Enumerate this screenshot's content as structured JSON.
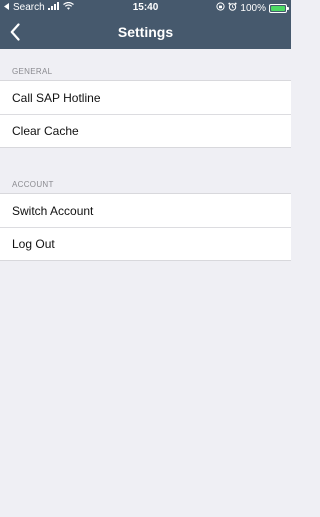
{
  "status_bar": {
    "carrier": "Search",
    "time": "15:40",
    "battery_percent": "100%",
    "battery_level": 1.0,
    "icons": [
      "back-arrow-small-icon",
      "signal-bars-icon",
      "wifi-icon",
      "orientation-lock-icon",
      "alarm-icon",
      "battery-charging-icon"
    ]
  },
  "nav": {
    "title": "Settings",
    "back_icon": "chevron-left-icon"
  },
  "sections": {
    "general": {
      "header": "GENERAL",
      "items": [
        "Call SAP Hotline",
        "Clear Cache"
      ]
    },
    "account": {
      "header": "ACCOUNT",
      "items": [
        "Switch Account",
        "Log Out"
      ]
    }
  },
  "colors": {
    "header_bg": "#46596d",
    "page_bg": "#efeff4",
    "battery_fill": "#4cd964"
  }
}
